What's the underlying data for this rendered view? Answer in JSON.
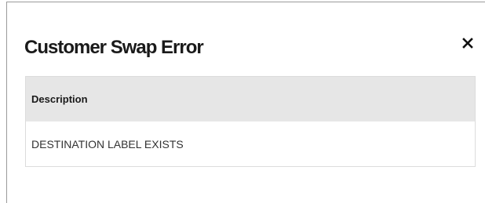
{
  "dialog": {
    "title": "Customer Swap Error",
    "close_icon": "close-icon"
  },
  "table": {
    "columns": [
      "Description"
    ],
    "rows": [
      [
        "DESTINATION LABEL EXISTS"
      ]
    ]
  },
  "colors": {
    "header_bg": "#e6e6e6",
    "title_text": "#1a1a1a",
    "border": "#dcdcdc"
  }
}
